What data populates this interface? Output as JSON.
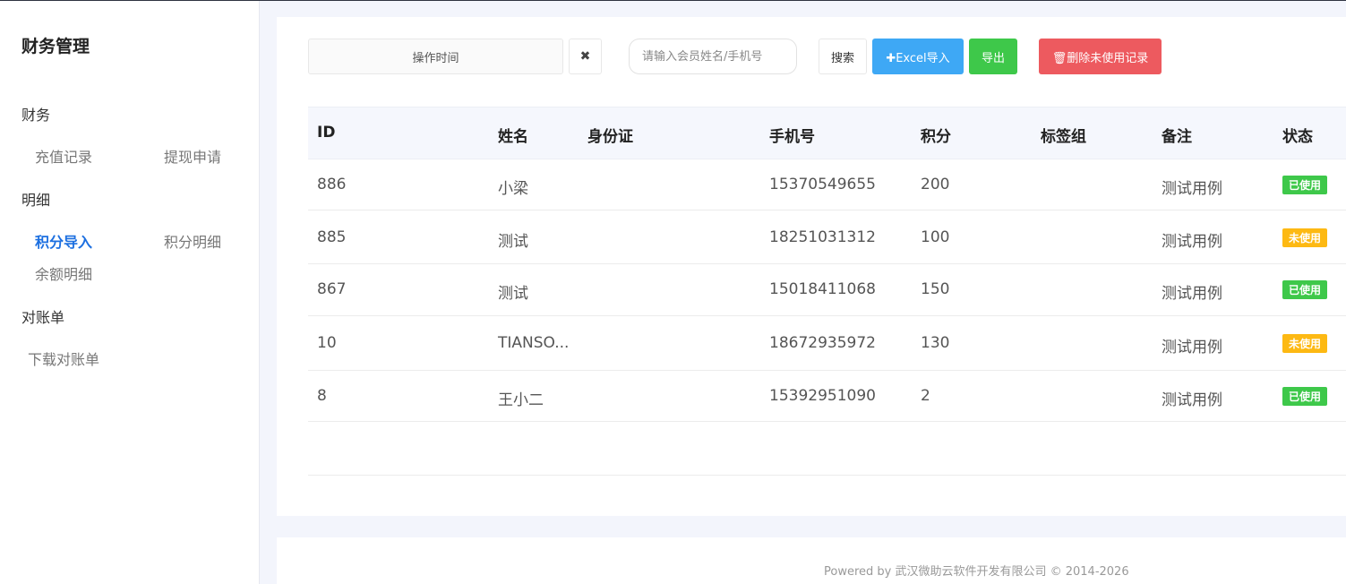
{
  "sidebar": {
    "title": "财务管理",
    "sections": [
      {
        "label": "财务",
        "items": [
          {
            "label": "充值记录"
          },
          {
            "label": "提现申请"
          }
        ]
      },
      {
        "label": "明细",
        "items": [
          {
            "label": "积分导入",
            "active": true
          },
          {
            "label": "积分明细"
          },
          {
            "label": "余额明细"
          }
        ]
      },
      {
        "label": "对账单",
        "items": [
          {
            "label": "下载对账单"
          }
        ]
      }
    ]
  },
  "toolbar": {
    "date_placeholder": "操作时间",
    "clear_label": "✖",
    "search_placeholder": "请输入会员姓名/手机号",
    "search_label": "搜索",
    "excel_label": "✚Excel导入",
    "export_label": "导出",
    "delete_label": "🗑删除未使用记录"
  },
  "table": {
    "headers": [
      "ID",
      "姓名",
      "身份证",
      "手机号",
      "积分",
      "标签组",
      "备注",
      "状态"
    ],
    "rows": [
      {
        "id": "886",
        "name": "小梁",
        "id_card": "",
        "phone": "15370549655",
        "points": "200",
        "tags": "",
        "note": "测试用例",
        "status": "已使用",
        "status_type": "used"
      },
      {
        "id": "885",
        "name": "测试",
        "id_card": "",
        "phone": "18251031312",
        "points": "100",
        "tags": "",
        "note": "测试用例",
        "status": "未使用",
        "status_type": "unused"
      },
      {
        "id": "867",
        "name": "测试",
        "id_card": "",
        "phone": "15018411068",
        "points": "150",
        "tags": "",
        "note": "测试用例",
        "status": "已使用",
        "status_type": "used"
      },
      {
        "id": "10",
        "name": "TIANSO...",
        "id_card": "",
        "phone": "18672935972",
        "points": "130",
        "tags": "",
        "note": "测试用例",
        "status": "未使用",
        "status_type": "unused"
      },
      {
        "id": "8",
        "name": "王小二",
        "id_card": "",
        "phone": "15392951090",
        "points": "2",
        "tags": "",
        "note": "测试用例",
        "status": "已使用",
        "status_type": "used"
      }
    ]
  },
  "status_colors": {
    "used": "#3ec84a",
    "unused": "#fdb913"
  },
  "footer": {
    "text": "Powered by 武汉微助云软件开发有限公司 © 2014-2026"
  }
}
